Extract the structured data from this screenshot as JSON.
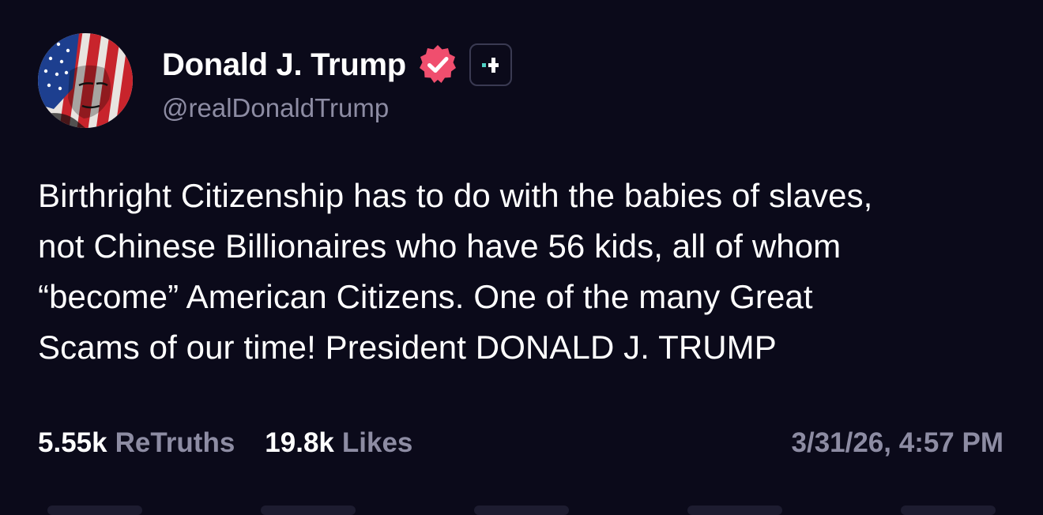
{
  "author": {
    "display_name": "Donald J. Trump",
    "handle": "@realDonaldTrump",
    "avatar_icon": "patriotic-portrait-avatar",
    "verified_icon": "verified-badge-icon",
    "follow_icon": "follow-plus-icon"
  },
  "post": {
    "lines": [
      "Birthright Citizenship has to do with the babies of slaves,",
      "not Chinese Billionaires who have 56 kids, all of whom",
      "“become” American Citizens. One of the many Great",
      "Scams of our time! President DONALD J. TRUMP"
    ]
  },
  "stats": {
    "retruths_count": "5.55k",
    "retruths_label": "ReTruths",
    "likes_count": "19.8k",
    "likes_label": "Likes"
  },
  "timestamp": "3/31/26, 4:57 PM",
  "colors": {
    "background": "#0b0a1a",
    "text_primary": "#ffffff",
    "text_secondary": "#8d8ca3",
    "verified_badge": "#f04e6e",
    "accent_teal": "#4fd1c5"
  }
}
